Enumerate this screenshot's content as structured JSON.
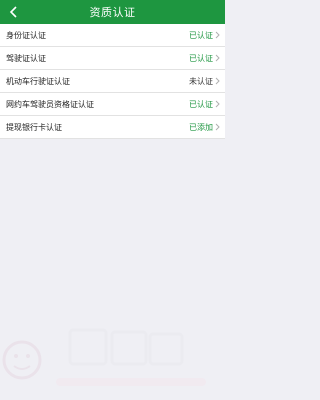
{
  "header": {
    "title": "资质认证"
  },
  "items": [
    {
      "label": "身份证认证",
      "status": "已认证",
      "state": "ok"
    },
    {
      "label": "驾驶证认证",
      "status": "已认证",
      "state": "ok"
    },
    {
      "label": "机动车行驶证认证",
      "status": "未认证",
      "state": "no"
    },
    {
      "label": "网约车驾驶员资格证认证",
      "status": "已认证",
      "state": "ok"
    },
    {
      "label": "提现银行卡认证",
      "status": "已添加",
      "state": "ok"
    }
  ],
  "colors": {
    "accent": "#1e9640",
    "background": "#efeff4"
  }
}
